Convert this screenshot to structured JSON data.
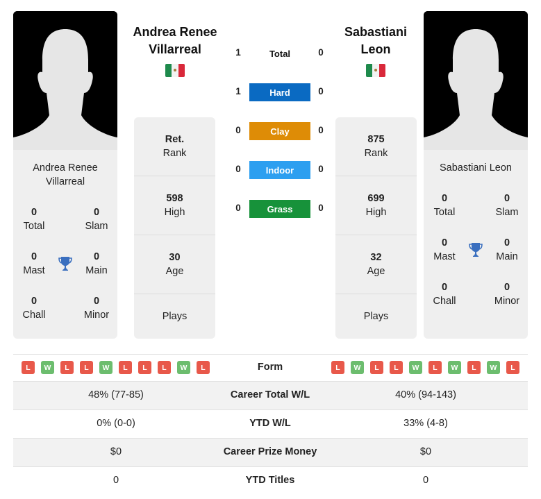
{
  "player1": {
    "name": "Andrea Renee Villarreal",
    "name_line1": "Andrea Renee",
    "name_line2": "Villarreal",
    "country_flag": "mexico-flag",
    "titles": {
      "total": {
        "value": "0",
        "label": "Total"
      },
      "slam": {
        "value": "0",
        "label": "Slam"
      },
      "mast": {
        "value": "0",
        "label": "Mast"
      },
      "main": {
        "value": "0",
        "label": "Main"
      },
      "chall": {
        "value": "0",
        "label": "Chall"
      },
      "minor": {
        "value": "0",
        "label": "Minor"
      }
    },
    "stats": {
      "rank": {
        "value": "Ret.",
        "label": "Rank"
      },
      "high": {
        "value": "598",
        "label": "High"
      },
      "age": {
        "value": "30",
        "label": "Age"
      },
      "plays": {
        "value": "",
        "label": "Plays"
      }
    },
    "form": [
      "L",
      "W",
      "L",
      "L",
      "W",
      "L",
      "L",
      "L",
      "W",
      "L"
    ]
  },
  "player2": {
    "name": "Sabastiani Leon",
    "name_line1": "Sabastiani",
    "name_line2": "Leon",
    "country_flag": "mexico-flag",
    "titles": {
      "total": {
        "value": "0",
        "label": "Total"
      },
      "slam": {
        "value": "0",
        "label": "Slam"
      },
      "mast": {
        "value": "0",
        "label": "Mast"
      },
      "main": {
        "value": "0",
        "label": "Main"
      },
      "chall": {
        "value": "0",
        "label": "Chall"
      },
      "minor": {
        "value": "0",
        "label": "Minor"
      }
    },
    "stats": {
      "rank": {
        "value": "875",
        "label": "Rank"
      },
      "high": {
        "value": "699",
        "label": "High"
      },
      "age": {
        "value": "32",
        "label": "Age"
      },
      "plays": {
        "value": "",
        "label": "Plays"
      }
    },
    "form": [
      "L",
      "W",
      "L",
      "L",
      "W",
      "L",
      "W",
      "L",
      "W",
      "L"
    ]
  },
  "h2h": [
    {
      "label": "Total",
      "p1": "1",
      "p2": "0",
      "color": ""
    },
    {
      "label": "Hard",
      "p1": "1",
      "p2": "0",
      "color": "#0a6ac2"
    },
    {
      "label": "Clay",
      "p1": "0",
      "p2": "0",
      "color": "#de8c06"
    },
    {
      "label": "Indoor",
      "p1": "0",
      "p2": "0",
      "color": "#2d9ff0"
    },
    {
      "label": "Grass",
      "p1": "0",
      "p2": "0",
      "color": "#17923a"
    }
  ],
  "form_label": "Form",
  "comparison": [
    {
      "label": "Career Total W/L",
      "p1": "48% (77-85)",
      "p2": "40% (94-143)"
    },
    {
      "label": "YTD W/L",
      "p1": "0% (0-0)",
      "p2": "33% (4-8)"
    },
    {
      "label": "Career Prize Money",
      "p1": "$0",
      "p2": "$0"
    },
    {
      "label": "YTD Titles",
      "p1": "0",
      "p2": "0"
    }
  ],
  "colors": {
    "win": "#6cbd6e",
    "loss": "#e8584a",
    "trophy": "#3a6fbf"
  }
}
